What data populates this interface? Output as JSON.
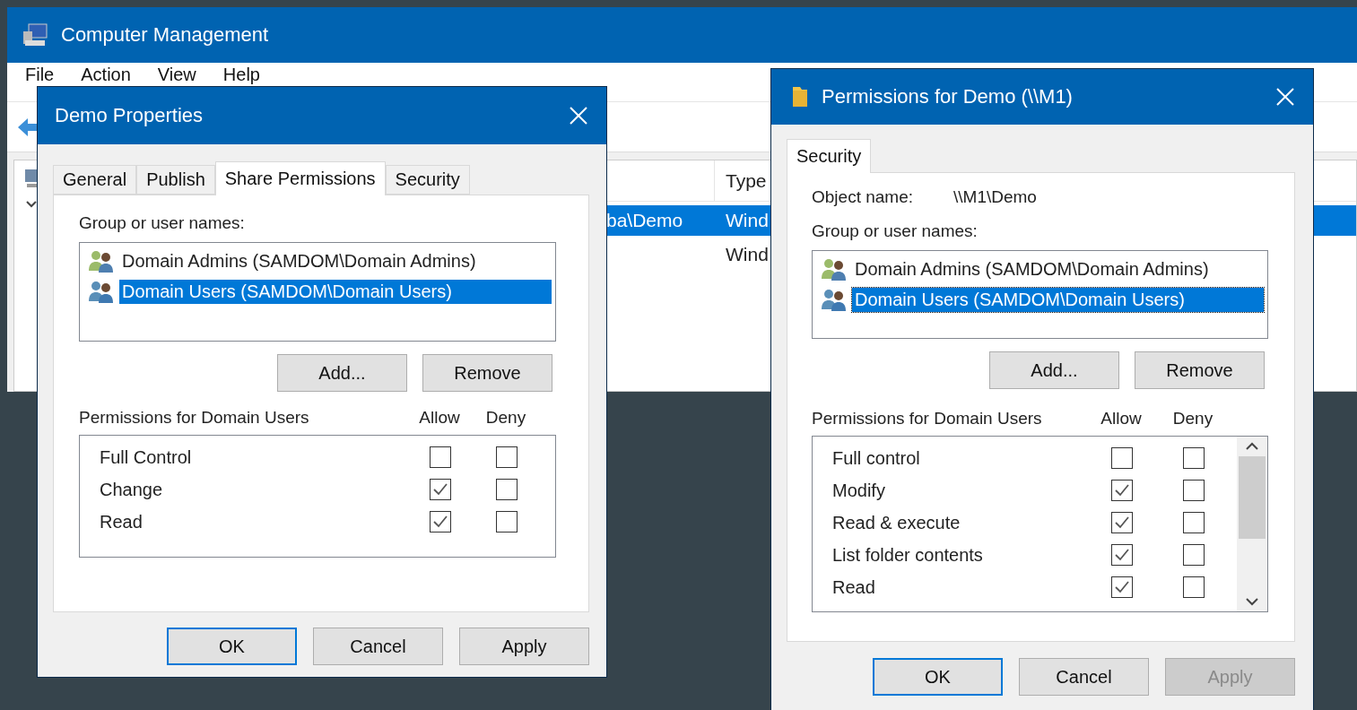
{
  "background_window": {
    "title": "Computer Management",
    "menu": [
      "File",
      "Action",
      "View",
      "Help"
    ],
    "list": {
      "columns": [
        "Type"
      ],
      "rows": [
        {
          "column_1": "ba\\Demo",
          "type": "Wind",
          "selected": true
        },
        {
          "type": "Wind",
          "selected": false
        }
      ]
    }
  },
  "properties_dialog": {
    "title": "Demo Properties",
    "tabs": [
      {
        "label": "General",
        "selected": false
      },
      {
        "label": "Publish",
        "selected": false
      },
      {
        "label": "Share Permissions",
        "selected": true
      },
      {
        "label": "Security",
        "selected": false
      }
    ],
    "group_label": "Group or user names:",
    "principals": [
      {
        "name": "Domain Admins (SAMDOM\\Domain Admins)",
        "kind": "admins",
        "selected": false
      },
      {
        "name": "Domain Users (SAMDOM\\Domain Users)",
        "kind": "users",
        "selected": true
      }
    ],
    "list_buttons": [
      "Add...",
      "Remove"
    ],
    "permissions_label": "Permissions for Domain Users",
    "allow_label": "Allow",
    "deny_label": "Deny",
    "permissions": [
      {
        "name": "Full Control",
        "allow": false,
        "deny": false
      },
      {
        "name": "Change",
        "allow": true,
        "deny": false
      },
      {
        "name": "Read",
        "allow": true,
        "deny": false
      }
    ],
    "footer_buttons": [
      {
        "label": "OK",
        "default": true,
        "disabled": false
      },
      {
        "label": "Cancel",
        "default": false,
        "disabled": false
      },
      {
        "label": "Apply",
        "default": false,
        "disabled": false
      }
    ]
  },
  "permissions_dialog": {
    "title": "Permissions for Demo (\\\\M1)",
    "tabs": [
      {
        "label": "Security",
        "selected": true
      }
    ],
    "object_name_label": "Object name:",
    "object_name": "\\\\M1\\Demo",
    "group_label": "Group or user names:",
    "principals": [
      {
        "name": "Domain Admins (SAMDOM\\Domain Admins)",
        "kind": "admins",
        "selected": false
      },
      {
        "name": "Domain Users (SAMDOM\\Domain Users)",
        "kind": "users",
        "selected": true
      }
    ],
    "list_buttons": [
      "Add...",
      "Remove"
    ],
    "permissions_label": "Permissions for Domain Users",
    "allow_label": "Allow",
    "deny_label": "Deny",
    "permissions": [
      {
        "name": "Full control",
        "allow": false,
        "deny": false
      },
      {
        "name": "Modify",
        "allow": true,
        "deny": false
      },
      {
        "name": "Read & execute",
        "allow": true,
        "deny": false
      },
      {
        "name": "List folder contents",
        "allow": true,
        "deny": false
      },
      {
        "name": "Read",
        "allow": true,
        "deny": false
      }
    ],
    "footer_buttons": [
      {
        "label": "OK",
        "default": true,
        "disabled": false
      },
      {
        "label": "Cancel",
        "default": false,
        "disabled": false
      },
      {
        "label": "Apply",
        "default": false,
        "disabled": true
      }
    ]
  }
}
